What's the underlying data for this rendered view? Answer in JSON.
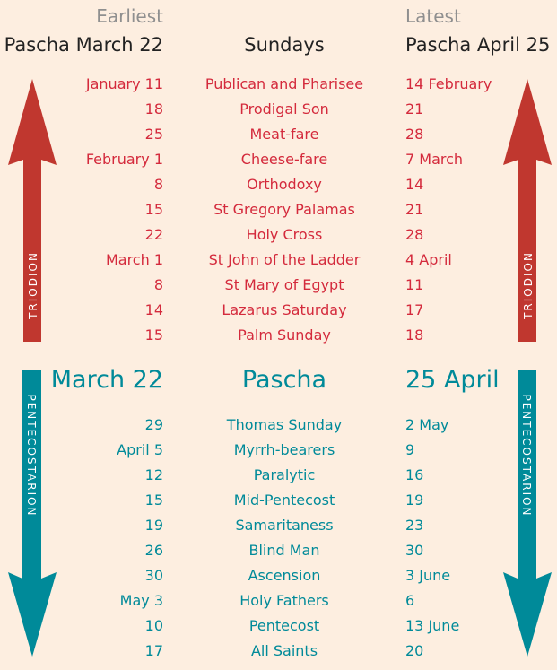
{
  "header": {
    "earliest_label": "Earliest",
    "latest_label": "Latest",
    "earliest_title": "Pascha March 22",
    "center_title": "Sundays",
    "latest_title": "Pascha April 25"
  },
  "colors": {
    "background": "#fdeee0",
    "triodion": "#c0372f",
    "triodion_text": "#d42a3c",
    "pentecostarion": "#008a99",
    "gray": "#8f8f8f"
  },
  "triodion": {
    "arrow_label": "TRIODION",
    "arrow_direction": "up",
    "rows": [
      {
        "earliest": "January 11",
        "sunday": "Publican and Pharisee",
        "latest": "14 February"
      },
      {
        "earliest": "18",
        "sunday": "Prodigal Son",
        "latest": "21"
      },
      {
        "earliest": "25",
        "sunday": "Meat-fare",
        "latest": "28"
      },
      {
        "earliest": "February 1",
        "sunday": "Cheese-fare",
        "latest": "7 March"
      },
      {
        "earliest": "8",
        "sunday": "Orthodoxy",
        "latest": "14"
      },
      {
        "earliest": "15",
        "sunday": "St Gregory Palamas",
        "latest": "21"
      },
      {
        "earliest": "22",
        "sunday": "Holy Cross",
        "latest": "28"
      },
      {
        "earliest": "March 1",
        "sunday": "St John of the Ladder",
        "latest": "4 April"
      },
      {
        "earliest": "8",
        "sunday": "St Mary of Egypt",
        "latest": "11"
      },
      {
        "earliest": "14",
        "sunday": "Lazarus Saturday",
        "latest": "17"
      },
      {
        "earliest": "15",
        "sunday": "Palm Sunday",
        "latest": "18"
      }
    ]
  },
  "pascha": {
    "earliest": "March 22",
    "center": "Pascha",
    "latest": "25 April"
  },
  "pentecostarion": {
    "arrow_label": "PENTECOSTARION",
    "arrow_direction": "down",
    "rows": [
      {
        "earliest": "29",
        "sunday": "Thomas Sunday",
        "latest": "2 May"
      },
      {
        "earliest": "April 5",
        "sunday": "Myrrh-bearers",
        "latest": "9"
      },
      {
        "earliest": "12",
        "sunday": "Paralytic",
        "latest": "16"
      },
      {
        "earliest": "15",
        "sunday": "Mid-Pentecost",
        "latest": "19"
      },
      {
        "earliest": "19",
        "sunday": "Samaritaness",
        "latest": "23"
      },
      {
        "earliest": "26",
        "sunday": "Blind Man",
        "latest": "30"
      },
      {
        "earliest": "30",
        "sunday": "Ascension",
        "latest": "3 June"
      },
      {
        "earliest": "May 3",
        "sunday": "Holy Fathers",
        "latest": "6"
      },
      {
        "earliest": "10",
        "sunday": "Pentecost",
        "latest": "13 June"
      },
      {
        "earliest": "17",
        "sunday": "All Saints",
        "latest": "20"
      }
    ]
  }
}
